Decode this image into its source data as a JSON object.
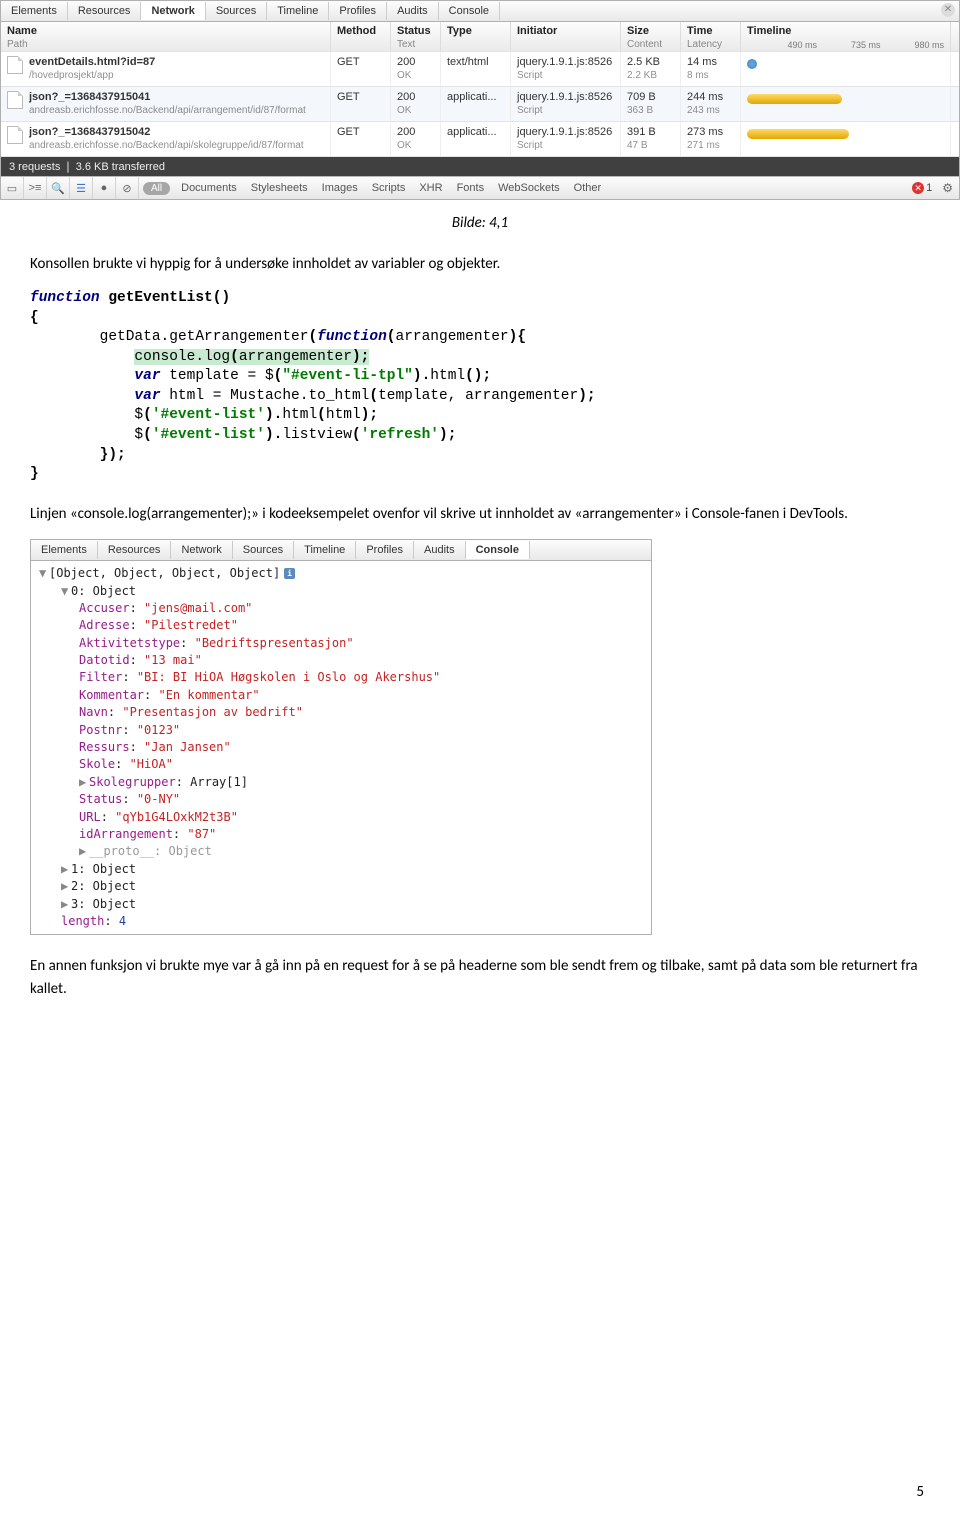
{
  "devtools": {
    "tabs": [
      "Elements",
      "Resources",
      "Network",
      "Sources",
      "Timeline",
      "Profiles",
      "Audits",
      "Console"
    ],
    "header": {
      "name": "Name",
      "name_sub": "Path",
      "method": "Method",
      "status": "Status",
      "status_sub": "Text",
      "type": "Type",
      "initiator": "Initiator",
      "size": "Size",
      "size_sub": "Content",
      "time": "Time",
      "time_sub": "Latency",
      "timeline": "Timeline",
      "ticks": [
        "490 ms",
        "735 ms",
        "980 ms"
      ]
    },
    "rows": [
      {
        "name": "eventDetails.html?id=87",
        "path": "/hovedprosjekt/app",
        "method": "GET",
        "status": "200",
        "status_sub": "OK",
        "type": "text/html",
        "initiator": "jquery.1.9.1.js:8526",
        "initiator_sub": "Script",
        "size": "2.5 KB",
        "size_sub": "2.2 KB",
        "time": "14 ms",
        "time_sub": "8 ms",
        "bar": "dot"
      },
      {
        "name": "json?_=1368437915041",
        "path": "andreasb.erichfosse.no/Backend/api/arrangement/id/87/format",
        "method": "GET",
        "status": "200",
        "status_sub": "OK",
        "type": "applicati...",
        "initiator": "jquery.1.9.1.js:8526",
        "initiator_sub": "Script",
        "size": "709 B",
        "size_sub": "363 B",
        "time": "244 ms",
        "time_sub": "243 ms",
        "bar": "y1"
      },
      {
        "name": "json?_=1368437915042",
        "path": "andreasb.erichfosse.no/Backend/api/skolegruppe/id/87/format",
        "method": "GET",
        "status": "200",
        "status_sub": "OK",
        "type": "applicati...",
        "initiator": "jquery.1.9.1.js:8526",
        "initiator_sub": "Script",
        "size": "391 B",
        "size_sub": "47 B",
        "time": "273 ms",
        "time_sub": "271 ms",
        "bar": "y2"
      }
    ],
    "status": "3 requests  ❘  3.6 KB transferred",
    "filters": [
      "Documents",
      "Stylesheets",
      "Images",
      "Scripts",
      "XHR",
      "Fonts",
      "WebSockets",
      "Other"
    ],
    "all": "All",
    "err": "1"
  },
  "caption": "Bilde: 4,1",
  "para1": "Konsollen brukte vi hyppig for å undersøke innholdet av variabler og objekter.",
  "code": {
    "fn_kw": "function",
    "fn_name": " getEventList",
    "op1": "()",
    "ob": "{",
    "l1a": "getData.getArrangementer",
    "l1b": "(",
    "l1kw": "function",
    "l1c": "(",
    "l1d": "arrangementer",
    "l1e": "){",
    "l2a": "console.log",
    "l2b": "(",
    "l2c": "arrangementer",
    "l2d": ");",
    "l3kw": "var",
    "l3a": " template = $",
    "l3b": "(",
    "l3str": "\"#event-li-tpl\"",
    "l3c": ").",
    "l3d": "html",
    "l3e": "();",
    "l4kw": "var",
    "l4a": " html = Mustache.to_html",
    "l4b": "(",
    "l4c": "template, arrangementer",
    "l4d": ");",
    "l5a": "$",
    "l5b": "(",
    "l5str": "'#event-list'",
    "l5c": ").",
    "l5d": "html",
    "l5e": "(",
    "l5f": "html",
    "l5g": ");",
    "l6a": "$",
    "l6b": "(",
    "l6str": "'#event-list'",
    "l6c": ").",
    "l6d": "listview",
    "l6e": "(",
    "l6str2": "'refresh'",
    "l6f": ");",
    "l7": "});",
    "cb": "}"
  },
  "para2": "Linjen «console.log(arrangementer);» i kodeeksempelet ovenfor vil skrive ut innholdet av «arrangementer» i Console-fanen i DevTools.",
  "console": {
    "tabs": [
      "Elements",
      "Resources",
      "Network",
      "Sources",
      "Timeline",
      "Profiles",
      "Audits",
      "Console"
    ],
    "top": "[Object, Object, Object, Object]",
    "idx0": "0: Object",
    "props": [
      {
        "k": "Accuser",
        "v": "\"jens@mail.com\""
      },
      {
        "k": "Adresse",
        "v": "\"Pilestredet\""
      },
      {
        "k": "Aktivitetstype",
        "v": "\"Bedriftspresentasjon\""
      },
      {
        "k": "Datotid",
        "v": "\"13 mai\""
      },
      {
        "k": "Filter",
        "v": "\"BI: BI HiOA Høgskolen i Oslo og Akershus\""
      },
      {
        "k": "Kommentar",
        "v": "\"En kommentar\""
      },
      {
        "k": "Navn",
        "v": "\"Presentasjon av bedrift\""
      },
      {
        "k": "Postnr",
        "v": "\"0123\""
      },
      {
        "k": "Ressurs",
        "v": "\"Jan Jansen\""
      },
      {
        "k": "Skole",
        "v": "\"HiOA\""
      }
    ],
    "skolegrupper_k": "Skolegrupper",
    "skolegrupper_v": "Array[1]",
    "status_k": "Status",
    "status_v": "\"0-NY\"",
    "url_k": "URL",
    "url_v": "\"qYb1G4LOxkM2t3B\"",
    "idarr_k": "idArrangement",
    "idarr_v": "\"87\"",
    "proto": "__proto__: Object",
    "idx1": "1: Object",
    "idx2": "2: Object",
    "idx3": "3: Object",
    "len_k": "length",
    "len_v": "4"
  },
  "para3": "En annen funksjon vi brukte mye var å gå inn på en request for å se på headerne som ble sendt frem og tilbake, samt på data som ble returnert fra kallet.",
  "pagenum": "5"
}
